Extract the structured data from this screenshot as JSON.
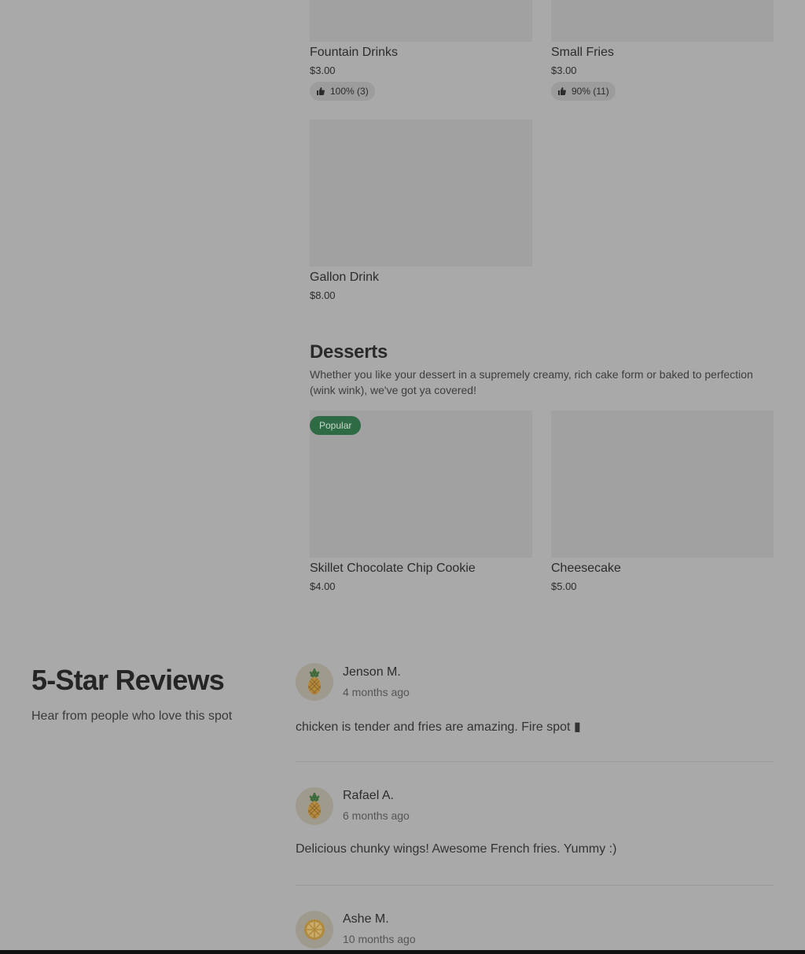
{
  "menu": {
    "drinks_items": [
      {
        "name": "Fountain Drinks",
        "price": "$3.00",
        "rating": "100% (3)"
      },
      {
        "name": "Small Fries",
        "price": "$3.00",
        "rating": "90% (11)"
      },
      {
        "name": "Gallon Drink",
        "price": "$8.00"
      }
    ],
    "desserts": {
      "title": "Desserts",
      "description": "Whether you like your dessert in a supremely creamy, rich cake form or baked to perfection (wink wink), we've got ya covered!",
      "badge": "Popular",
      "items": [
        {
          "name": "Skillet Chocolate Chip Cookie",
          "price": "$4.00"
        },
        {
          "name": "Cheesecake",
          "price": "$5.00"
        }
      ]
    }
  },
  "reviews": {
    "title": "5-Star Reviews",
    "subtitle": "Hear from people who love this spot",
    "items": [
      {
        "name": "Jenson M.",
        "time": "4 months ago",
        "text": "chicken is tender and fries are amazing. Fire spot ▮",
        "avatar_icon": "pineapple-icon"
      },
      {
        "name": "Rafael A.",
        "time": "6 months ago",
        "text": "Delicious chunky wings! Awesome French fries. Yummy :)",
        "avatar_icon": "pineapple-icon"
      },
      {
        "name": "Ashe M.",
        "time": "10 months ago",
        "avatar_icon": "citrus-icon"
      }
    ]
  },
  "colors": {
    "overlay_bg": "#a9a9a9",
    "badge_bg": "#2e6b45"
  }
}
